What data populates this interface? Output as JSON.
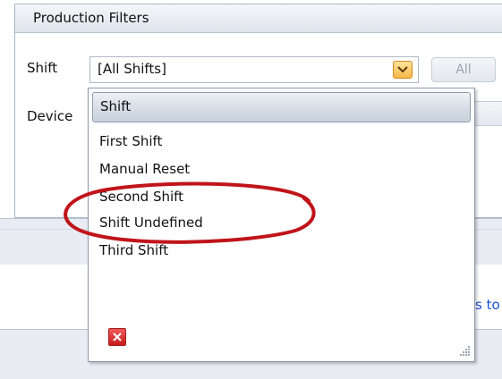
{
  "panel": {
    "title": "Production Filters"
  },
  "filters": {
    "shift_label": "Shift",
    "shift_value": "[All Shifts]",
    "device_label": "Device",
    "all_button": "All"
  },
  "dropdown": {
    "header": "Shift",
    "options": [
      "First Shift",
      "Manual Reset",
      "Second Shift",
      "Shift Undefined",
      "Third Shift"
    ],
    "highlighted_option": "Shift Undefined"
  },
  "background": {
    "truncated_link": "s to"
  },
  "colors": {
    "annotation": "#c0141a",
    "accent": "#f7b84a",
    "link": "#1a4fd6"
  },
  "icons": {
    "dropdown": "chevron-down-icon",
    "close": "close-icon",
    "grip": "resize-grip-icon"
  }
}
